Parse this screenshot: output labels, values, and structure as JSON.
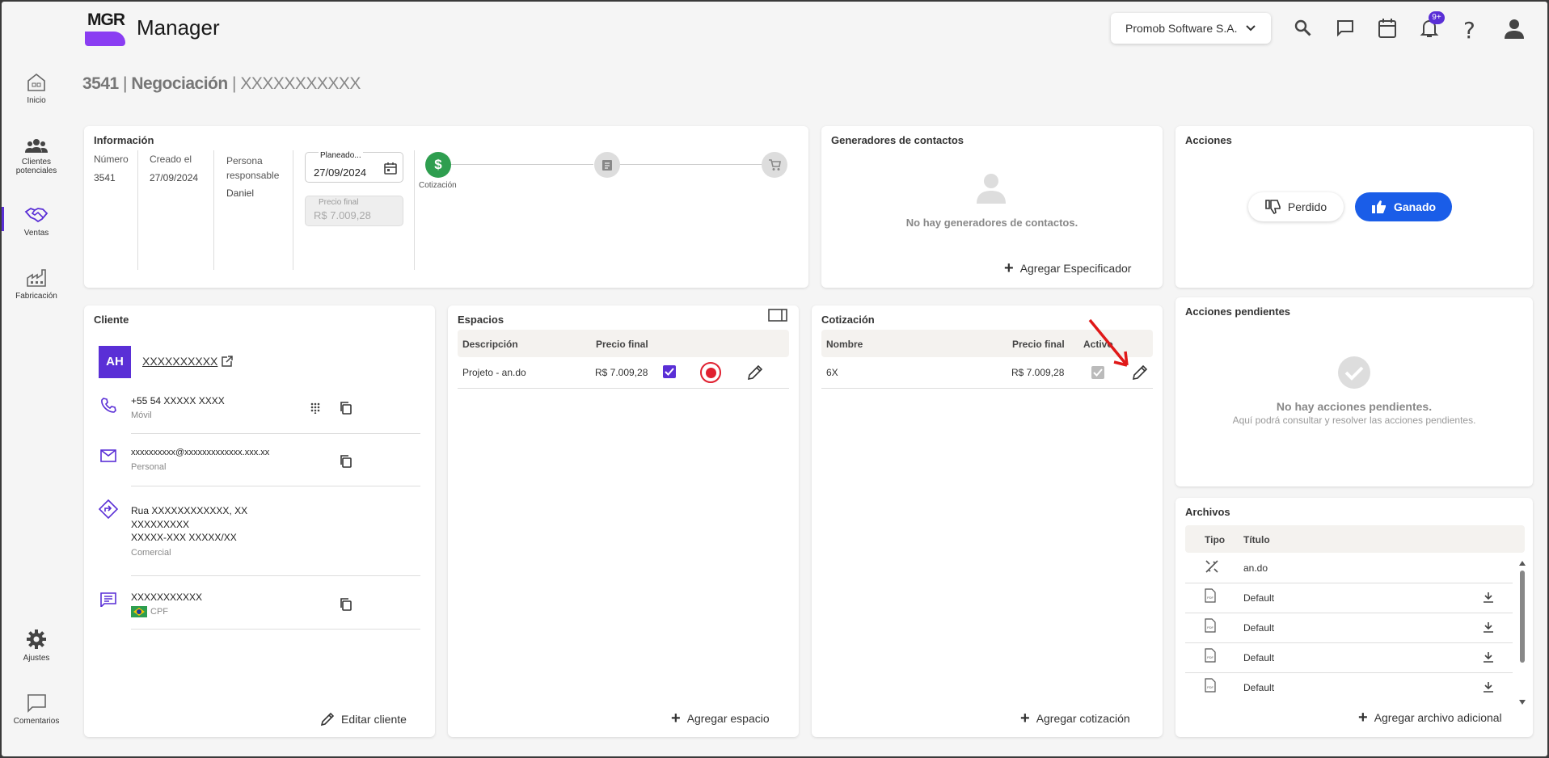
{
  "app": {
    "logo_text": "MGR",
    "title": "Manager"
  },
  "header": {
    "company": "Promob Software S.A.",
    "badge": "9+"
  },
  "page_title": {
    "number": "3541",
    "sep1": " | ",
    "section": "Negociación",
    "sep2": " | ",
    "name": "XXXXXXXXXXX"
  },
  "sidebar": {
    "items": [
      {
        "label": "Inicio",
        "icon": "home-icon"
      },
      {
        "label": "Clientes potenciales",
        "icon": "people-icon"
      },
      {
        "label": "Ventas",
        "icon": "handshake-icon",
        "active": true
      },
      {
        "label": "Fabricación",
        "icon": "factory-icon"
      },
      {
        "label": "Ajustes",
        "icon": "gear-icon"
      },
      {
        "label": "Comentarios",
        "icon": "comment-icon"
      }
    ]
  },
  "info": {
    "title": "Información",
    "numero_label": "Número",
    "numero": "3541",
    "creado_label": "Creado el",
    "creado": "27/09/2024",
    "persona_label1": "Persona",
    "persona_label2": "responsable",
    "persona": "Daniel",
    "planeado_label": "Planeado...",
    "planeado": "27/09/2024",
    "precio_label": "Precio final",
    "precio": "R$ 7.009,28",
    "steps": [
      {
        "label": "Cotización",
        "state": "done"
      },
      {
        "label": "",
        "state": "pending"
      },
      {
        "label": "",
        "state": "pending"
      }
    ]
  },
  "generadores": {
    "title": "Generadores de contactos",
    "empty": "No hay generadores de contactos.",
    "add": "Agregar Especificador"
  },
  "acciones": {
    "title": "Acciones",
    "lost": "Perdido",
    "won": "Ganado"
  },
  "pendientes": {
    "title": "Acciones pendientes",
    "empty": "No hay acciones pendientes.",
    "hint": "Aquí podrá consultar y resolver las acciones pendientes."
  },
  "cliente": {
    "title": "Cliente",
    "avatar": "AH",
    "name": "XXXXXXXXXX",
    "phone": "+55 54 XXXXX XXXX",
    "phone_type": "Móvil",
    "email": "xxxxxxxxxx@xxxxxxxxxxxxx.xxx.xx",
    "email_type": "Personal",
    "address1": "Rua XXXXXXXXXXXX, XX",
    "address2": "XXXXXXXXX",
    "address3": "XXXXX-XXX  XXXXX/XX",
    "address_type": "Comercial",
    "doc": "XXXXXXXXXXX",
    "doc_type": "CPF",
    "edit": "Editar cliente"
  },
  "espacios": {
    "title": "Espacios",
    "headers": [
      "Descripción",
      "Precio final"
    ],
    "rows": [
      {
        "desc": "Projeto - an.do",
        "price": "R$ 7.009,28"
      }
    ],
    "add": "Agregar espacio"
  },
  "cotizacion": {
    "title": "Cotización",
    "headers": [
      "Nombre",
      "Precio final",
      "Activo"
    ],
    "rows": [
      {
        "name": "6X",
        "price": "R$ 7.009,28"
      }
    ],
    "add": "Agregar cotización"
  },
  "archivos": {
    "title": "Archivos",
    "headers": [
      "Tipo",
      "Título"
    ],
    "rows": [
      {
        "type": "design",
        "title": "an.do"
      },
      {
        "type": "pdf",
        "title": "Default"
      },
      {
        "type": "pdf",
        "title": "Default"
      },
      {
        "type": "pdf",
        "title": "Default"
      },
      {
        "type": "pdf",
        "title": "Default"
      }
    ],
    "add": "Agregar archivo adicional"
  },
  "colors": {
    "accent": "#5a2fd6",
    "primary": "#1a5de8",
    "success": "#2e9e4f",
    "annotation": "#e01818"
  }
}
